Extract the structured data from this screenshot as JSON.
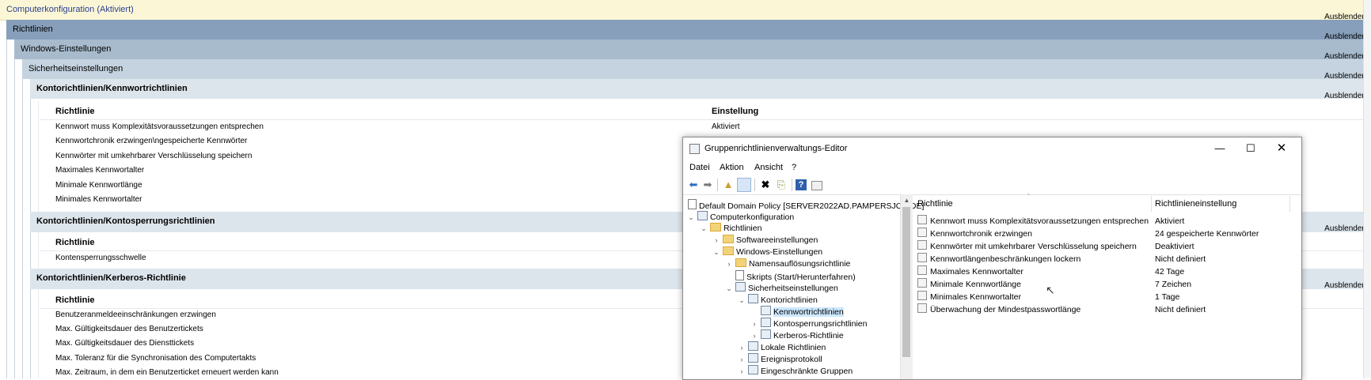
{
  "report": {
    "hide_label": "Ausblenden",
    "computer_config": "Computerkonfiguration (Aktiviert)",
    "policies": "Richtlinien",
    "windows_settings": "Windows-Einstellungen",
    "security_settings": "Sicherheitseinstellungen",
    "sections": [
      {
        "title": "Kontorichtlinien/Kennwortrichtlinien",
        "col_policy": "Richtlinie",
        "col_setting": "Einstellung",
        "rows": [
          {
            "policy": "Kennwort muss Komplexitätsvoraussetzungen entsprechen",
            "setting": "Aktiviert"
          },
          {
            "policy": "Kennwortchronik erzwingen\\ngespeicherte Kennwörter",
            "setting": ""
          },
          {
            "policy": "Kennwörter mit umkehrbarer Verschlüsselung speichern",
            "setting": ""
          },
          {
            "policy": "Maximales Kennwortalter",
            "setting": ""
          },
          {
            "policy": "Minimale Kennwortlänge",
            "setting": ""
          },
          {
            "policy": "Minimales Kennwortalter",
            "setting": ""
          }
        ]
      },
      {
        "title": "Kontorichtlinien/Kontosperrungsrichtlinien",
        "col_policy": "Richtlinie",
        "rows": [
          {
            "policy": "Kontensperrungsschwelle"
          }
        ]
      },
      {
        "title": "Kontorichtlinien/Kerberos-Richtlinie",
        "col_policy": "Richtlinie",
        "rows": [
          {
            "policy": "Benutzeranmeldeeinschränkungen erzwingen"
          },
          {
            "policy": "Max. Gültigkeitsdauer des Benutzertickets"
          },
          {
            "policy": "Max. Gültigkeitsdauer des Diensttickets"
          },
          {
            "policy": "Max. Toleranz für die Synchronisation des Computertakts"
          },
          {
            "policy": "Max. Zeitraum, in dem ein Benutzerticket erneuert werden kann"
          }
        ]
      }
    ]
  },
  "window": {
    "title": "Gruppenrichtlinienverwaltungs-Editor",
    "menu": [
      "Datei",
      "Aktion",
      "Ansicht",
      "?"
    ],
    "tree": [
      {
        "label": "Default Domain Policy [SERVER2022AD.PAMPERSJOE.DE]",
        "icon": "policy-icon"
      },
      {
        "label": "Computerkonfiguration",
        "icon": "computer-icon"
      },
      {
        "label": "Richtlinien",
        "icon": "folder-icon"
      },
      {
        "label": "Softwareeinstellungen",
        "icon": "folder-icon"
      },
      {
        "label": "Windows-Einstellungen",
        "icon": "folder-icon"
      },
      {
        "label": "Namensauflösungsrichtlinie",
        "icon": "folder-icon"
      },
      {
        "label": "Skripts (Start/Herunterfahren)",
        "icon": "script-icon"
      },
      {
        "label": "Sicherheitseinstellungen",
        "icon": "security-icon"
      },
      {
        "label": "Kontorichtlinien",
        "icon": "policy-folder-icon"
      },
      {
        "label": "Kennwortrichtlinien",
        "icon": "policy-folder-icon"
      },
      {
        "label": "Kontosperrungsrichtlinien",
        "icon": "policy-folder-icon"
      },
      {
        "label": "Kerberos-Richtlinie",
        "icon": "policy-folder-icon"
      },
      {
        "label": "Lokale Richtlinien",
        "icon": "policy-folder-icon"
      },
      {
        "label": "Ereignisprotokoll",
        "icon": "policy-folder-icon"
      },
      {
        "label": "Eingeschränkte Gruppen",
        "icon": "policy-folder-icon"
      }
    ],
    "list_headers": {
      "policy": "Richtlinie",
      "setting": "Richtlinieneinstellung"
    },
    "list_rows": [
      {
        "policy": "Kennwort muss Komplexitätsvoraussetzungen entsprechen",
        "setting": "Aktiviert"
      },
      {
        "policy": "Kennwortchronik erzwingen",
        "setting": "24 gespeicherte Kennwörter"
      },
      {
        "policy": "Kennwörter mit umkehrbarer Verschlüsselung speichern",
        "setting": "Deaktiviert"
      },
      {
        "policy": "Kennwortlängenbeschränkungen lockern",
        "setting": "Nicht definiert"
      },
      {
        "policy": "Maximales Kennwortalter",
        "setting": "42 Tage"
      },
      {
        "policy": "Minimale Kennwortlänge",
        "setting": "7 Zeichen"
      },
      {
        "policy": "Minimales Kennwortalter",
        "setting": "1 Tage"
      },
      {
        "policy": "Überwachung der Mindestpasswortlänge",
        "setting": "Nicht definiert"
      }
    ]
  }
}
